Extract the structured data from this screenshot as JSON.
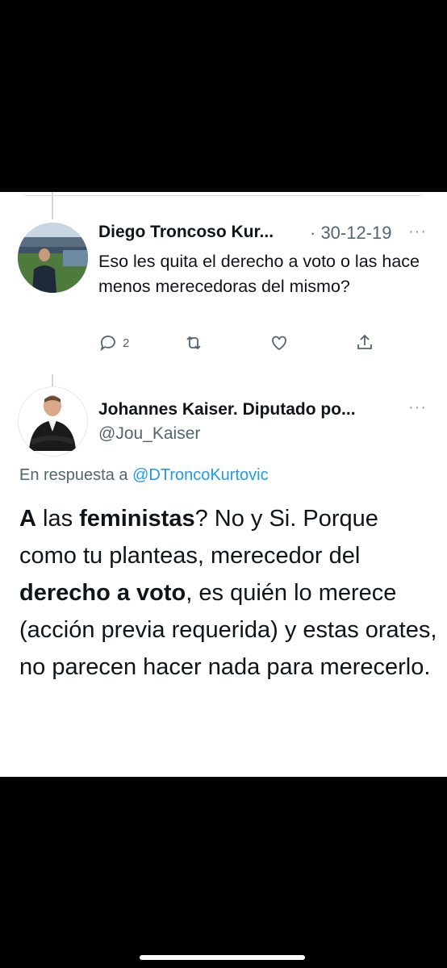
{
  "tweet1": {
    "author": "Diego Troncoso Kur...",
    "date": "· 30-12-19",
    "text": "Eso les quita el derecho a voto o las hace menos merecedoras del mismo?",
    "reply_count": "2",
    "icons": [
      "reply-icon",
      "retweet-icon",
      "like-icon",
      "share-icon"
    ]
  },
  "tweet2": {
    "author": "Johannes Kaiser. Diputado po...",
    "handle": "@Jou_Kaiser",
    "reply_prefix": "En respuesta a ",
    "reply_mention": "@DTroncoKurtovic",
    "text_parts": {
      "p1": "A",
      "p2": " las ",
      "p3": "feministas",
      "p4": "? No y Si. Porque como tu planteas, merecedor del ",
      "p5": "derecho a voto",
      "p6": ", es quién lo merece (acción previa requerida) y estas orates, no parecen hacer nada para merecerlo."
    }
  },
  "more_glyph": "···",
  "colors": {
    "background": "#000000",
    "card": "#ffffff",
    "text": "#0f1419",
    "secondary": "#536471",
    "link": "#1d9bf0"
  }
}
